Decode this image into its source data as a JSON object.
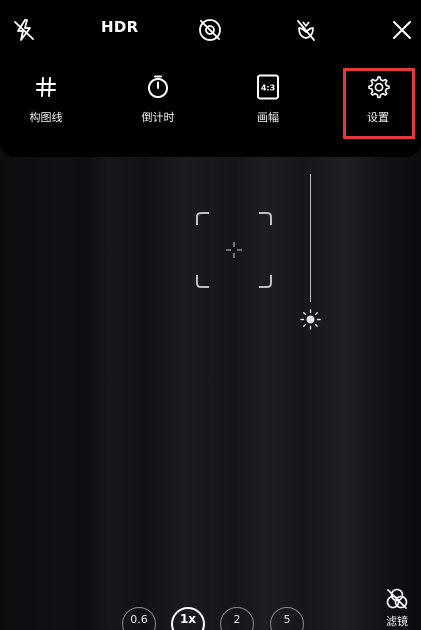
{
  "top_bar": {
    "flash_icon": "flash-off-icon",
    "hdr_label": "HDR",
    "live_photo_icon": "live-photo-off-icon",
    "macro_icon": "macro-off-icon",
    "close_icon": "close-icon"
  },
  "menu": {
    "items": [
      {
        "icon": "grid-icon",
        "label": "构图线"
      },
      {
        "icon": "timer-icon",
        "label": "倒计时"
      },
      {
        "icon": "aspect-ratio-icon",
        "label": "画幅",
        "badge": "4:3"
      },
      {
        "icon": "gear-icon",
        "label": "设置"
      }
    ],
    "highlight_color": "#e03a3a"
  },
  "zoom": {
    "levels": [
      "0.6",
      "1x",
      "2",
      "5"
    ],
    "selected": "1x"
  },
  "filter": {
    "icon": "filter-icon",
    "label": "滤镜"
  }
}
